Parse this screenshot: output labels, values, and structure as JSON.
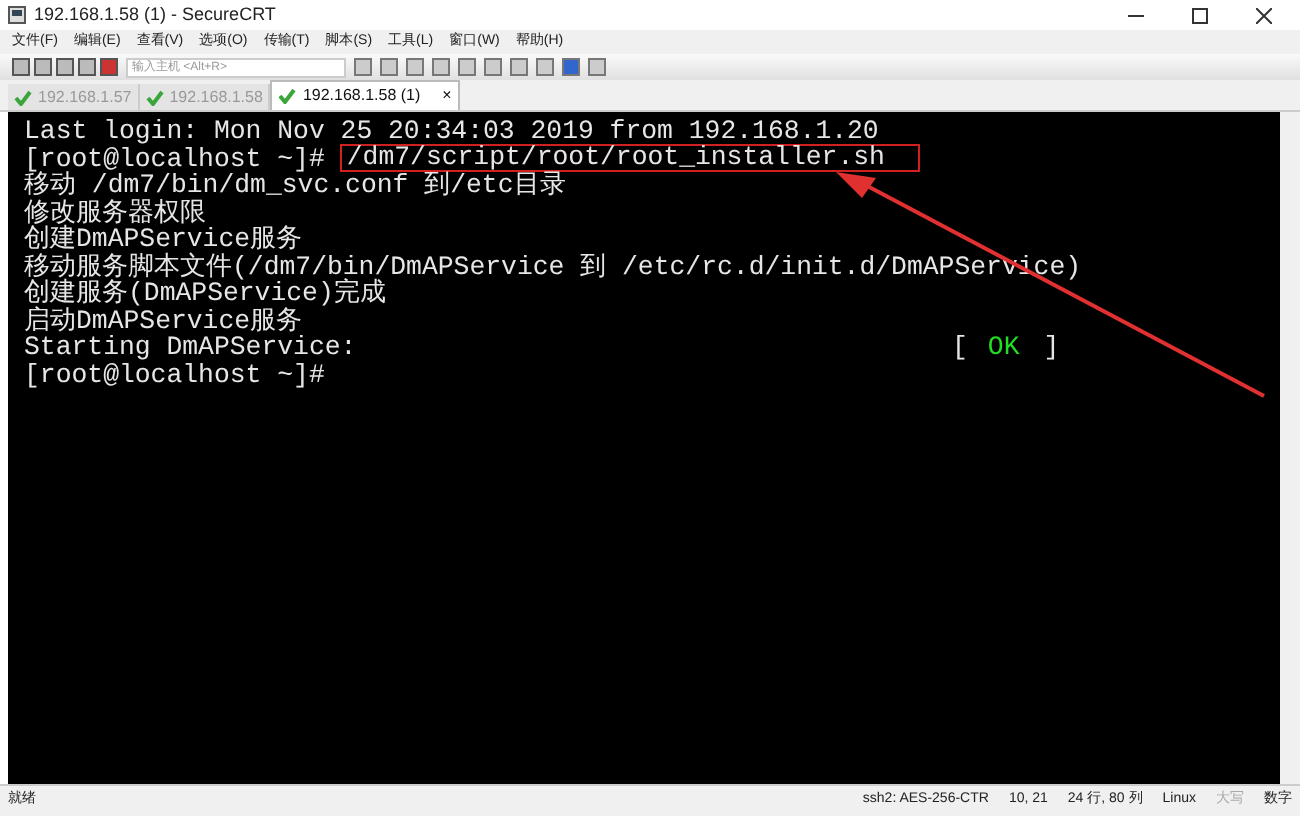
{
  "window": {
    "title": "192.168.1.58 (1) - SecureCRT"
  },
  "menu": [
    "文件(F)",
    "编辑(E)",
    "查看(V)",
    "选项(O)",
    "传输(T)",
    "脚本(S)",
    "工具(L)",
    "窗口(W)",
    "帮助(H)"
  ],
  "toolbar": {
    "host_field": {
      "placeholder": "输入主机 <Alt+R>"
    }
  },
  "tabs": [
    {
      "label": "192.168.1.57",
      "selected": false
    },
    {
      "label": "192.168.1.58",
      "selected": false
    },
    {
      "label": "192.168.1.58 (1)",
      "selected": true,
      "close": "×"
    }
  ],
  "terminal": {
    "lines": [
      {
        "kind": "plain",
        "text": "Last login: Mon Nov 25 20:34:03 2019 from 192.168.1.20"
      },
      {
        "kind": "command",
        "prompt": "[root@localhost ~]#",
        "text": "/dm7/script/root/root_installer.sh"
      },
      {
        "kind": "plain",
        "text": "移动 /dm7/bin/dm_svc.conf 到/etc目录"
      },
      {
        "kind": "plain",
        "text": "修改服务器权限"
      },
      {
        "kind": "plain",
        "text": "创建DmAPService服务"
      },
      {
        "kind": "plain",
        "text": "移动服务脚本文件(/dm7/bin/DmAPService 到 /etc/rc.d/init.d/DmAPService)"
      },
      {
        "kind": "plain",
        "text": "创建服务(DmAPService)完成"
      },
      {
        "kind": "plain",
        "text": "启动DmAPService服务"
      },
      {
        "kind": "status",
        "text": "Starting DmAPService:",
        "open": "[",
        "result": "OK",
        "close": "]"
      },
      {
        "kind": "prompt",
        "prompt": "[root@localhost ~]#"
      }
    ]
  },
  "status_bar": [
    {
      "label": "就绪",
      "active": true
    },
    {
      "label": "ssh2: AES-256-CTR",
      "active": true
    },
    {
      "label": "10, 21",
      "active": true
    },
    {
      "label": "24 行, 80 列",
      "active": true
    },
    {
      "label": "Linux",
      "active": true
    },
    {
      "label": "大写",
      "active": false
    },
    {
      "label": "数字",
      "active": true
    }
  ]
}
